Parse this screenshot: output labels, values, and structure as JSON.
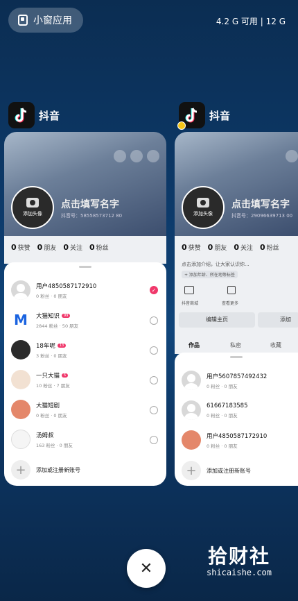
{
  "topbar": {
    "small_window_label": "小窗应用",
    "memory": "4.2 G 可用 | 12 G"
  },
  "apps": [
    {
      "name": "抖音",
      "profile": {
        "avatar_label": "添加头像",
        "name_placeholder": "点击填写名字",
        "id_text": "抖音号：58558573712 80",
        "stats": [
          {
            "n": "0",
            "l": "获赞"
          },
          {
            "n": "0",
            "l": "朋友"
          },
          {
            "n": "0",
            "l": "关注"
          },
          {
            "n": "0",
            "l": "粉丝"
          }
        ]
      },
      "accounts": [
        {
          "name": "用户4850587172910",
          "sub": "0 粉丝  · 0 朋友",
          "badge": "",
          "selected": true,
          "avatar": "default"
        },
        {
          "name": "大猫知识",
          "sub": "2844 粉丝 · 50 朋友",
          "badge": "99",
          "selected": false,
          "avatar": "m"
        },
        {
          "name": "18年呢",
          "sub": "3 粉丝  · 0 朋友",
          "badge": "13",
          "selected": false,
          "avatar": "dark"
        },
        {
          "name": "一只大猫",
          "sub": "10 粉丝 · 7 朋友",
          "badge": "5",
          "selected": false,
          "avatar": "girl"
        },
        {
          "name": "大猫短剧",
          "sub": "0 粉丝  · 0 朋友",
          "badge": "",
          "selected": false,
          "avatar": "cat"
        },
        {
          "name": "汤姆叔",
          "sub": "163 粉丝 · 0 朋友",
          "badge": "",
          "selected": false,
          "avatar": "boy"
        }
      ],
      "add_label": "添加或注册新账号"
    },
    {
      "name": "抖音",
      "profile": {
        "avatar_label": "添加头像",
        "name_placeholder": "点击填写名字",
        "id_text": "抖音号：29096639713 00",
        "stats": [
          {
            "n": "0",
            "l": "获赞"
          },
          {
            "n": "0",
            "l": "朋友"
          },
          {
            "n": "0",
            "l": "关注"
          },
          {
            "n": "0",
            "l": "粉丝"
          }
        ],
        "intro": "点击添加介绍，让大家认识你...",
        "tag": "+ 添加年龄、所在地等标签",
        "shortcuts": [
          "抖音商城",
          "查看更多"
        ],
        "edit": "编辑主页",
        "add": "添加",
        "tabs": [
          "作品",
          "私密",
          "收藏"
        ]
      },
      "accounts": [
        {
          "name": "用户5607857492432",
          "sub": "0 粉丝  · 0 朋友",
          "avatar": "default"
        },
        {
          "name": "61667183585",
          "sub": "0 粉丝  · 0 朋友",
          "avatar": "default"
        },
        {
          "name": "用户4850587172910",
          "sub": "0 粉丝  · 0 朋友",
          "avatar": "cat"
        }
      ],
      "add_label": "添加或注册新账号"
    }
  ],
  "watermark": {
    "title": "拾财社",
    "url": "shicaishe.com"
  },
  "close_glyph": "✕"
}
